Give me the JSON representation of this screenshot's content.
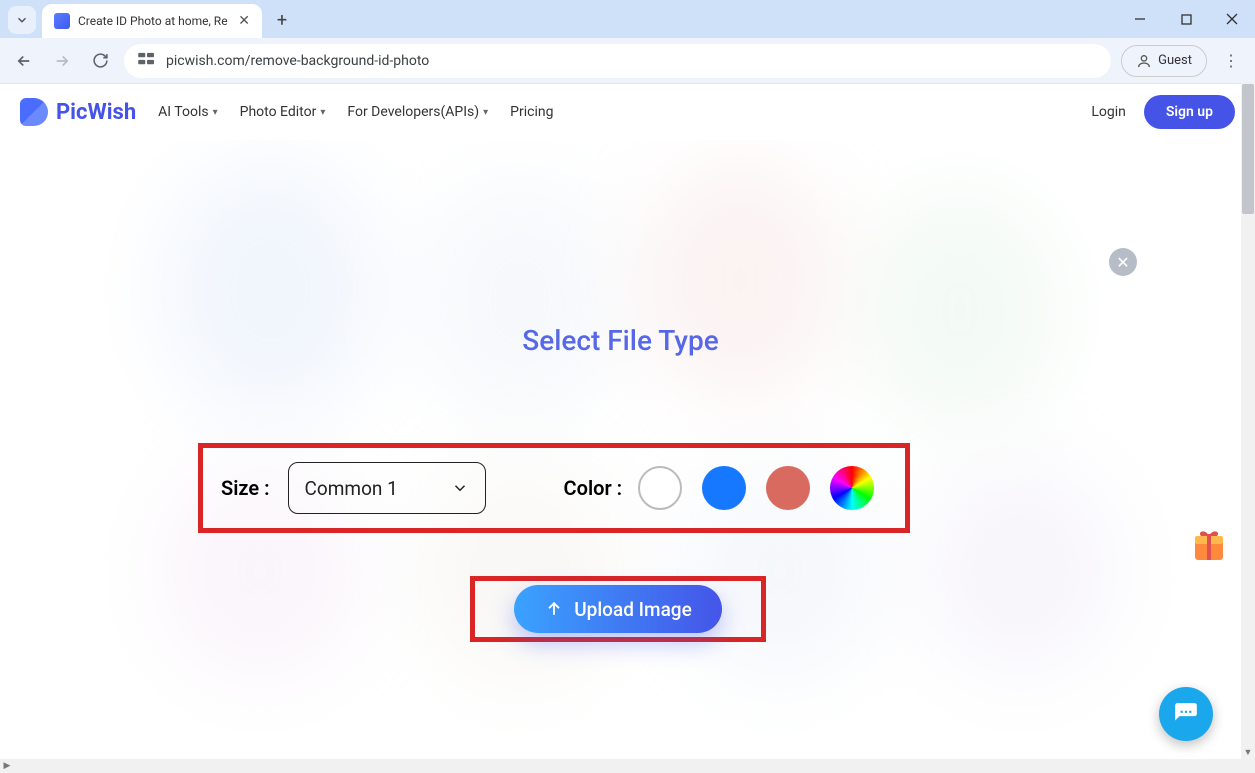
{
  "browser": {
    "tab_title": "Create ID Photo at home, Re",
    "url": "picwish.com/remove-background-id-photo",
    "guest_label": "Guest"
  },
  "header": {
    "logo_text": "PicWish",
    "nav": [
      "AI Tools",
      "Photo Editor",
      "For Developers(APIs)",
      "Pricing"
    ],
    "login": "Login",
    "signup": "Sign up"
  },
  "modal": {
    "title": "Select File Type",
    "size_label": "Size :",
    "size_value": "Common 1",
    "color_label": "Color :",
    "colors": [
      "white",
      "blue",
      "red",
      "rainbow"
    ],
    "upload_label": "Upload Image"
  }
}
